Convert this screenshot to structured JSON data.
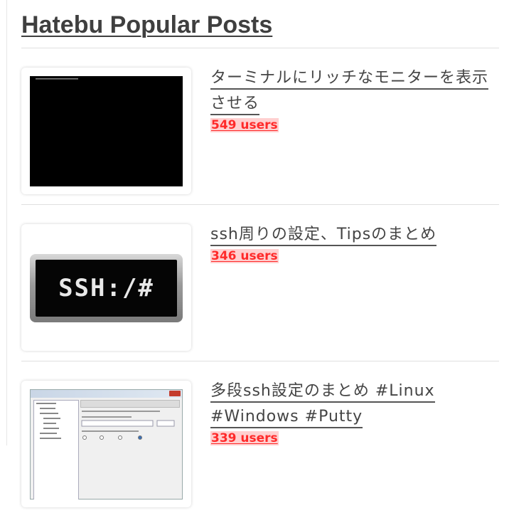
{
  "widget": {
    "title": "Hatebu Popular Posts"
  },
  "posts": [
    {
      "title": "ターミナルにリッチなモニターを表示させる",
      "users": "549 users",
      "thumb": "terminal-monitor"
    },
    {
      "title": "ssh周りの設定、Tipsのまとめ",
      "users": "346 users",
      "thumb": "ssh-logo",
      "thumb_text": "SSH:/#"
    },
    {
      "title": "多段ssh設定のまとめ #Linux #Windows #Putty",
      "users": "339 users",
      "thumb": "putty-configuration"
    }
  ],
  "colors": {
    "users_text": "#ff2a2a",
    "users_bg": "#ffd0d0",
    "title_text": "#444444"
  }
}
